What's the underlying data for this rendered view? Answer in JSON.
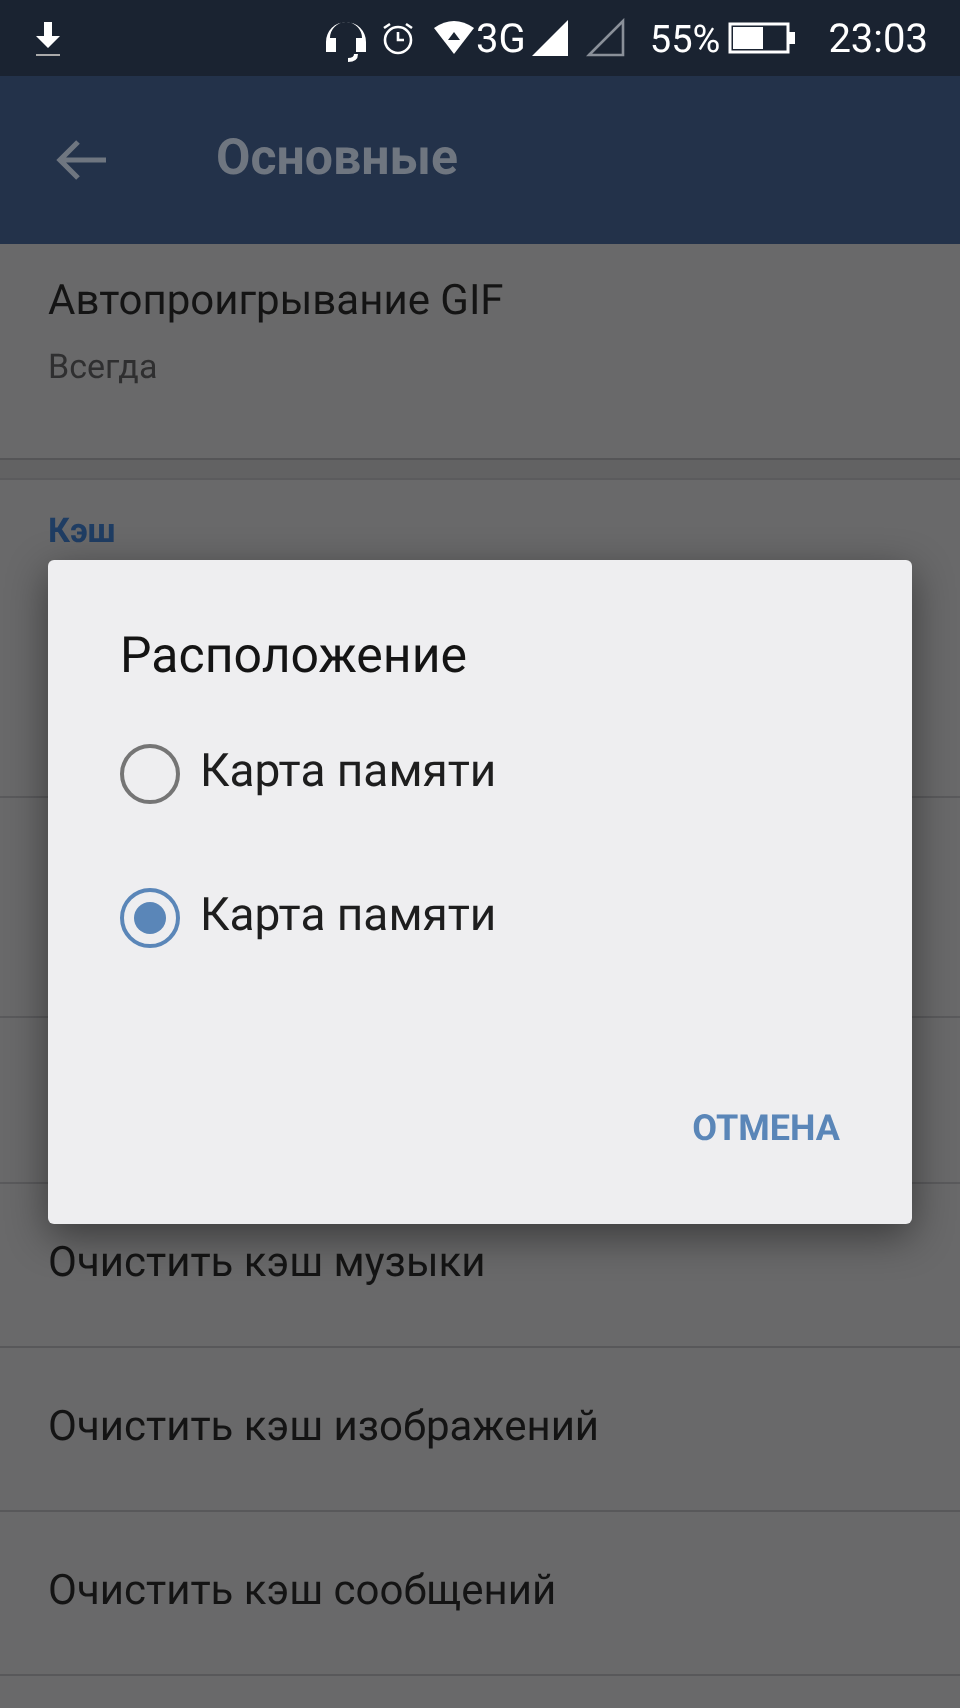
{
  "status_bar": {
    "network": "3G",
    "battery": "55%",
    "time": "23:03"
  },
  "app_bar": {
    "title": "Основные"
  },
  "settings": [
    {
      "title": "Автопроигрывание GIF",
      "subtitle": "Всегда"
    }
  ],
  "section_header": "Кэш",
  "cache_items": [
    {
      "title": "Очистить кэш музыки"
    },
    {
      "title": "Очистить кэш изображений"
    },
    {
      "title": "Очистить кэш сообщений"
    }
  ],
  "dialog": {
    "title": "Расположение",
    "options": [
      {
        "label": "Карта памяти",
        "selected": false
      },
      {
        "label": "Карта памяти",
        "selected": true
      }
    ],
    "buttons": [
      "ОТМЕНА"
    ]
  }
}
